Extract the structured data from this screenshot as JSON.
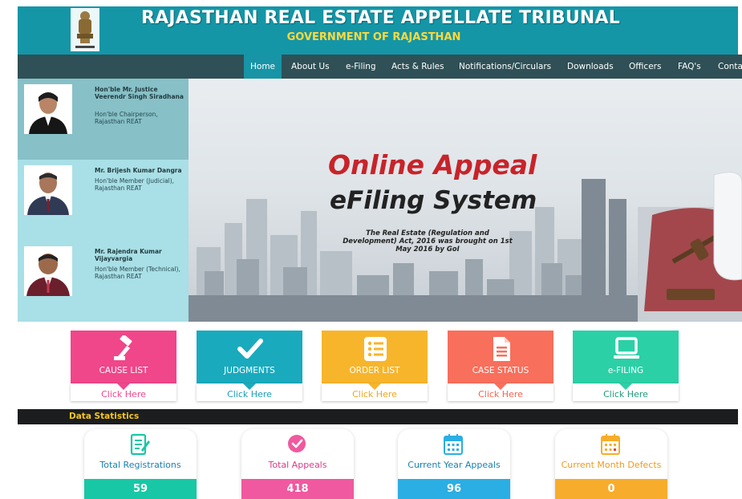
{
  "header": {
    "title": "RAJASTHAN REAL ESTATE APPELLATE TRIBUNAL",
    "subtitle": "GOVERNMENT OF RAJASTHAN",
    "emblem_icon": "state-emblem-icon"
  },
  "nav": {
    "items": [
      {
        "label": "Home",
        "active": true
      },
      {
        "label": "About Us"
      },
      {
        "label": "e-Filing"
      },
      {
        "label": "Acts & Rules"
      },
      {
        "label": "Notifications/Circulars"
      },
      {
        "label": "Downloads"
      },
      {
        "label": "Officers"
      },
      {
        "label": "FAQ's"
      },
      {
        "label": "Conta"
      }
    ]
  },
  "members": [
    {
      "name": "Hon'ble Mr. Justice Veerendr Singh Siradhana",
      "role": "Hon'ble Chairperson, Rajasthan REAT"
    },
    {
      "name": "Mr. Brijesh Kumar Dangra",
      "role": "Hon'ble Member (Judicial), Rajasthan REAT"
    },
    {
      "name": "Mr. Rajendra Kumar Vijayvargia",
      "role": "Hon'ble Member (Technical), Rajasthan REAT"
    }
  ],
  "banner": {
    "heading1": "Online Appeal",
    "heading2": "eFiling System",
    "text": "The Real Estate (Regulation and Development) Act, 2016 was brought on 1st May 2016 by GoI"
  },
  "quick_links": [
    {
      "label": "CAUSE LIST",
      "action": "Click Here",
      "icon": "gavel-icon",
      "color": "#f0468a"
    },
    {
      "label": "JUDGMENTS",
      "action": "Click Here",
      "icon": "checkmark-icon",
      "color": "#1aaabd"
    },
    {
      "label": "ORDER LIST",
      "action": "Click Here",
      "icon": "list-icon",
      "color": "#f7b52c"
    },
    {
      "label": "CASE STATUS",
      "action": "Click Here",
      "icon": "document-icon",
      "color": "#f86f5c"
    },
    {
      "label": "e-FILING",
      "action": "Click Here",
      "icon": "laptop-icon",
      "color": "#2bd0a6"
    }
  ],
  "stats": {
    "title": "Data Statistics",
    "items": [
      {
        "label": "Total Registrations",
        "value": "59",
        "icon": "registration-form-icon",
        "color": "#18c7a5",
        "label_color": "#1a7fb0"
      },
      {
        "label": "Total Appeals",
        "value": "418",
        "icon": "check-circle-icon",
        "color": "#f0599f",
        "label_color": "#d83d86"
      },
      {
        "label": "Current Year Appeals",
        "value": "96",
        "icon": "calendar-icon",
        "color": "#2baee3",
        "label_color": "#1a7fb0"
      },
      {
        "label": "Current Month Defects",
        "value": "0",
        "icon": "calendar-alert-icon",
        "color": "#f7ad2b",
        "label_color": "#f09a1a"
      }
    ]
  }
}
